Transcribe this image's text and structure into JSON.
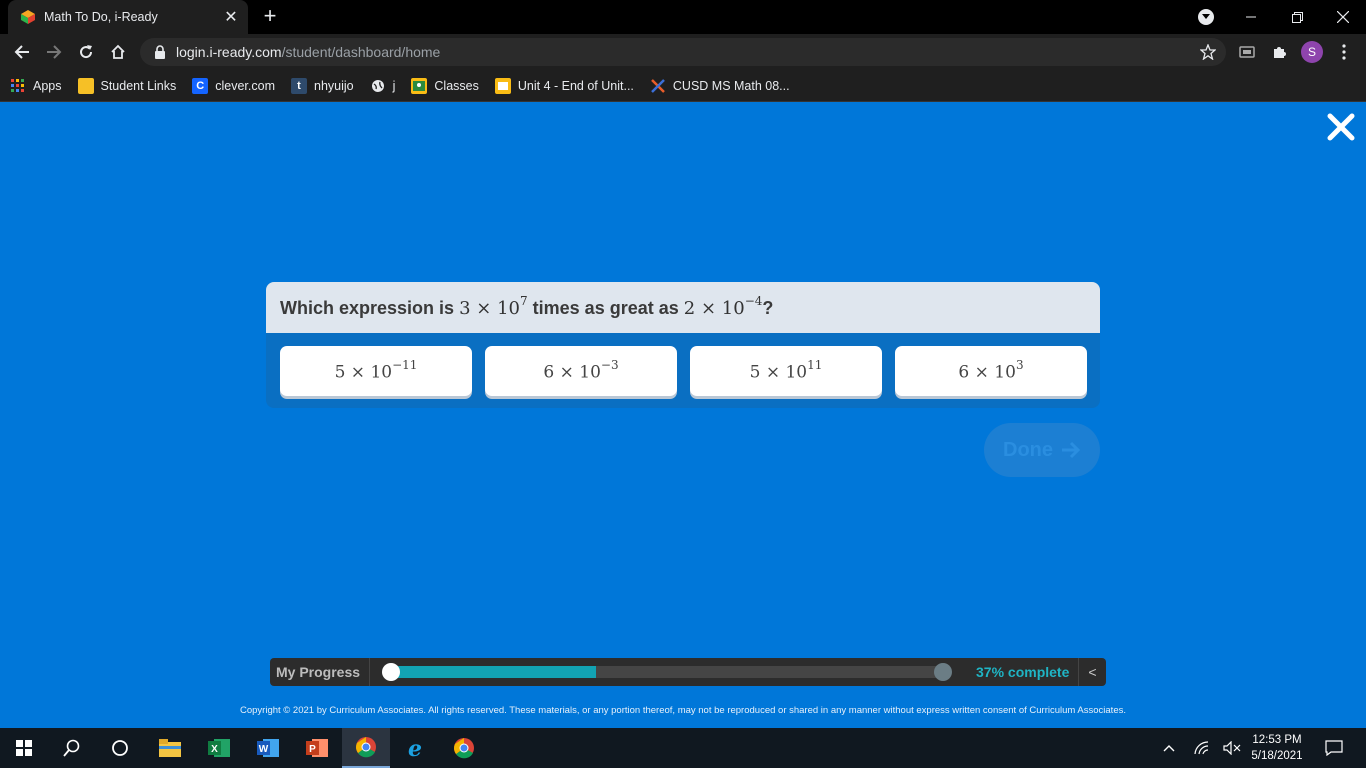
{
  "browser": {
    "tab": {
      "title": "Math To Do, i-Ready"
    },
    "url": {
      "host": "login.i-ready.com",
      "path": "/student/dashboard/home"
    },
    "profile_initial": "S",
    "bookmarks": [
      {
        "label": "Apps"
      },
      {
        "label": "Student Links"
      },
      {
        "label": "clever.com"
      },
      {
        "label": "nhyuijo"
      },
      {
        "label": "j"
      },
      {
        "label": "Classes"
      },
      {
        "label": "Unit 4 - End of Unit..."
      },
      {
        "label": "CUSD MS Math 08..."
      }
    ]
  },
  "question": {
    "prefix": "Which expression is",
    "term1": {
      "coef": "3",
      "base": "10",
      "exp": "7"
    },
    "middle": "times as great as",
    "term2": {
      "coef": "2",
      "base": "10",
      "exp": "−4"
    },
    "suffix": "?",
    "times_symbol": "×"
  },
  "answers": [
    {
      "coef": "5",
      "base": "10",
      "exp": "−11"
    },
    {
      "coef": "6",
      "base": "10",
      "exp": "−3"
    },
    {
      "coef": "5",
      "base": "10",
      "exp": "11"
    },
    {
      "coef": "6",
      "base": "10",
      "exp": "3"
    }
  ],
  "done_label": "Done",
  "progress": {
    "label": "My Progress",
    "percent_text": "37% complete",
    "fraction": 0.37,
    "collapse_label": "<"
  },
  "copyright": "Copyright © 2021 by Curriculum Associates. All rights reserved. These materials, or any portion thereof, may not be reproduced or shared in any manner without express written consent of Curriculum Associates.",
  "taskbar": {
    "time": "12:53 PM",
    "date": "5/18/2021"
  }
}
